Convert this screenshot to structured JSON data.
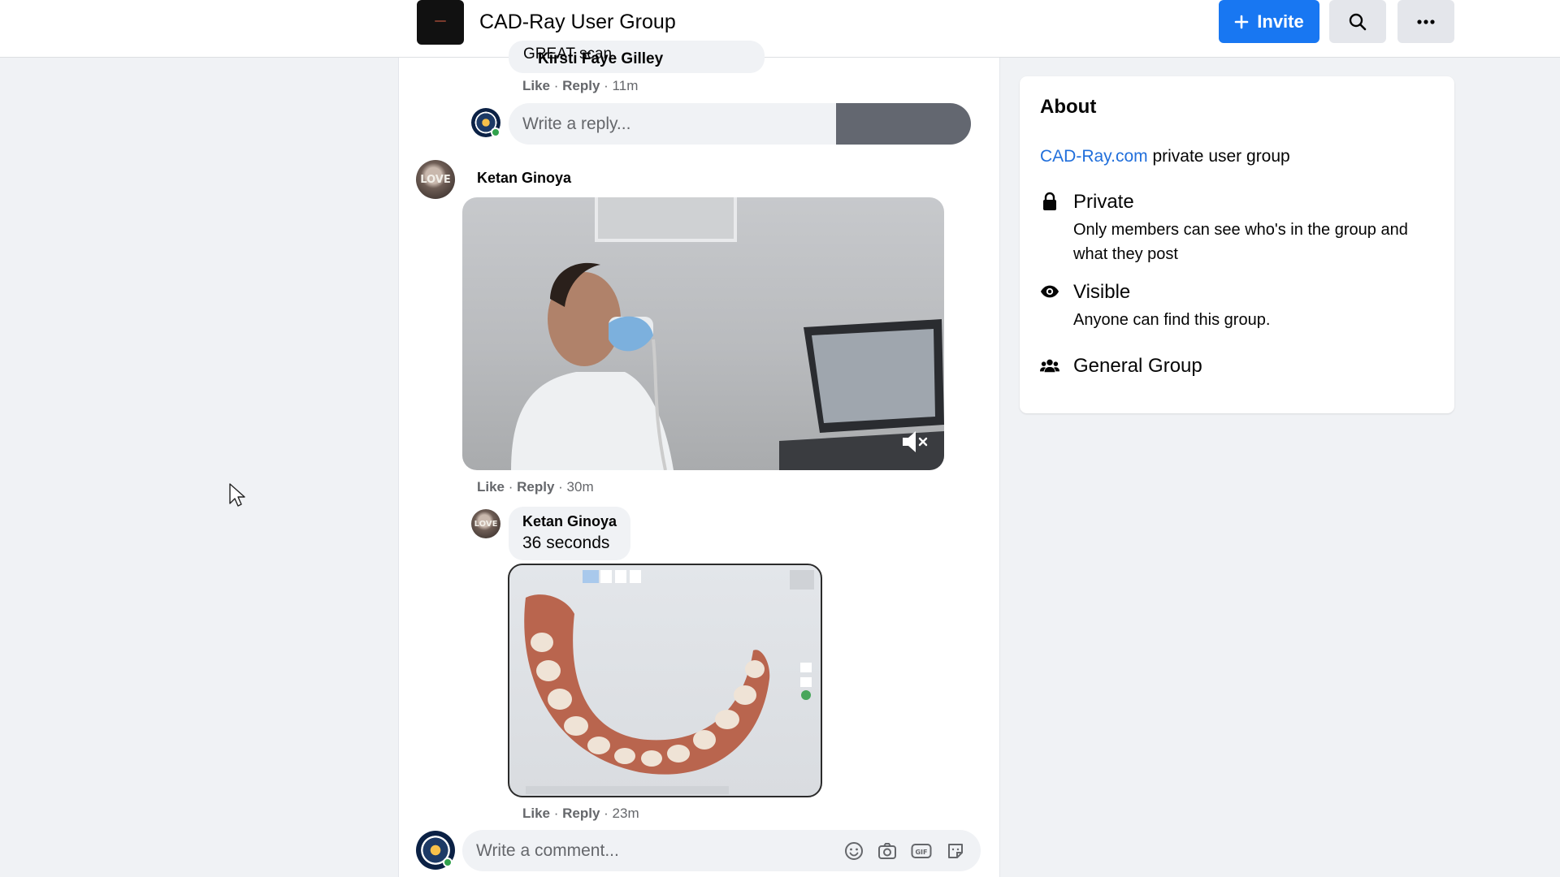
{
  "header": {
    "group_name": "CAD-Ray User Group",
    "invite_label": "Invite",
    "search_icon": "search-icon",
    "more_icon": "more-icon"
  },
  "feed": {
    "previous_comment": {
      "author": "Kirsti Faye Gilley",
      "text": "GREAT scan",
      "like": "Like",
      "reply": "Reply",
      "time": "11m"
    },
    "reply_input": {
      "placeholder": "Write a reply..."
    },
    "video_comment": {
      "author": "Ketan Ginoya",
      "like": "Like",
      "reply": "Reply",
      "time": "30m",
      "mute_icon": "volume-muted-icon"
    },
    "nested_reply": {
      "author": "Ketan Ginoya",
      "text": "36 seconds",
      "like": "Like",
      "reply": "Reply",
      "time": "23m"
    },
    "comment_input": {
      "placeholder": "Write a comment...",
      "icons": [
        "emoji-icon",
        "camera-icon",
        "gif-icon",
        "sticker-icon"
      ]
    }
  },
  "about": {
    "title": "About",
    "link_text": "CAD-Ray.com",
    "description_rest": " private user group",
    "privacy_title": "Private",
    "privacy_desc": "Only members can see who's in the group and what they post",
    "visibility_title": "Visible",
    "visibility_desc": "Anyone can find this group.",
    "type_title": "General Group"
  },
  "colors": {
    "accent": "#1877f2",
    "link": "#216fdb",
    "meta_text": "#65676b",
    "background": "#f0f2f5"
  }
}
